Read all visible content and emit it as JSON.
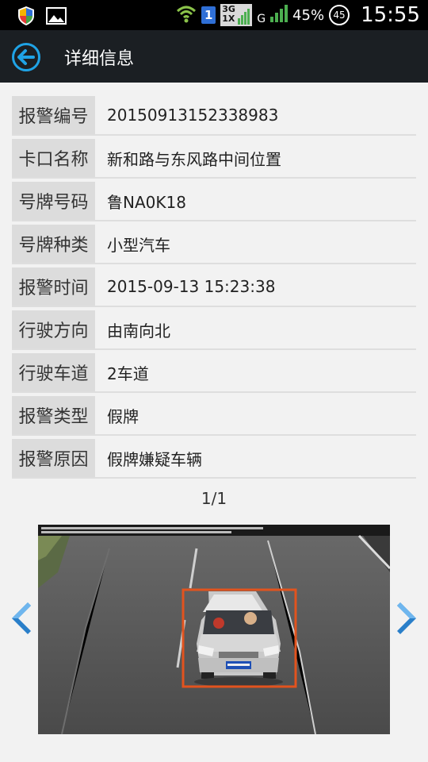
{
  "statusbar": {
    "battery_percent": "45%",
    "battery_circle": "45",
    "time": "15:55",
    "sim_slot": "1",
    "network_3g": "3G",
    "network_1x": "1X",
    "network_g": "G"
  },
  "appbar": {
    "title": "详细信息"
  },
  "details": [
    {
      "label": "报警编号",
      "value": "20150913152338983"
    },
    {
      "label": "卡口名称",
      "value": "新和路与东风路中间位置"
    },
    {
      "label": "号牌号码",
      "value": "鲁NA0K18"
    },
    {
      "label": "号牌种类",
      "value": "小型汽车"
    },
    {
      "label": "报警时间",
      "value": "2015-09-13 15:23:38"
    },
    {
      "label": "行驶方向",
      "value": "由南向北"
    },
    {
      "label": "行驶车道",
      "value": "2车道"
    },
    {
      "label": "报警类型",
      "value": "假牌"
    },
    {
      "label": "报警原因",
      "value": "假牌嫌疑车辆"
    }
  ],
  "pager": "1/1",
  "photo": {
    "plate_text": "鲁NA0K18",
    "highlight_color": "#e2531e"
  }
}
